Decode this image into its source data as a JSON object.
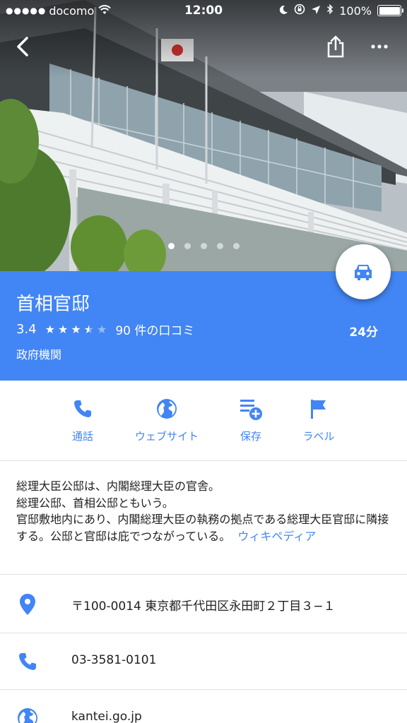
{
  "status_bar": {
    "signal": "●●●●●",
    "carrier": "docomo",
    "time": "12:00",
    "battery": "100%"
  },
  "place": {
    "name": "首相官邸",
    "rating": "3.4",
    "stars": 3.5,
    "reviews": "90 件の口コミ",
    "eta": "24分",
    "category": "政府機関"
  },
  "actions": {
    "call": "通話",
    "website": "ウェブサイト",
    "save": "保存",
    "label": "ラベル"
  },
  "description": {
    "text": "総理大臣公邸は、内閣総理大臣の官舎。\n総理公邸、首相公邸ともいう。\n官邸敷地内にあり、内閣総理大臣の執務の拠点である総理大臣官邸に隣接する。公邸と官邸は庇でつながっている。",
    "link": "ウィキペディア"
  },
  "details": {
    "address": "〒100-0014 東京都千代田区永田町２丁目３−１",
    "phone": "03-3581-0101",
    "website": "kantei.go.jp"
  },
  "colors": {
    "accent": "#4285f4",
    "header_bg": "#4285f4",
    "text": "#212121",
    "divider": "#e0e0e0"
  },
  "icons": {
    "back": "chevron-left-icon",
    "share": "share-icon",
    "more": "more-dots-icon",
    "directions": "car-icon",
    "call": "phone-icon",
    "website": "globe-icon",
    "save": "playlist-add-icon",
    "label": "flag-icon",
    "address": "location-pin-icon"
  }
}
